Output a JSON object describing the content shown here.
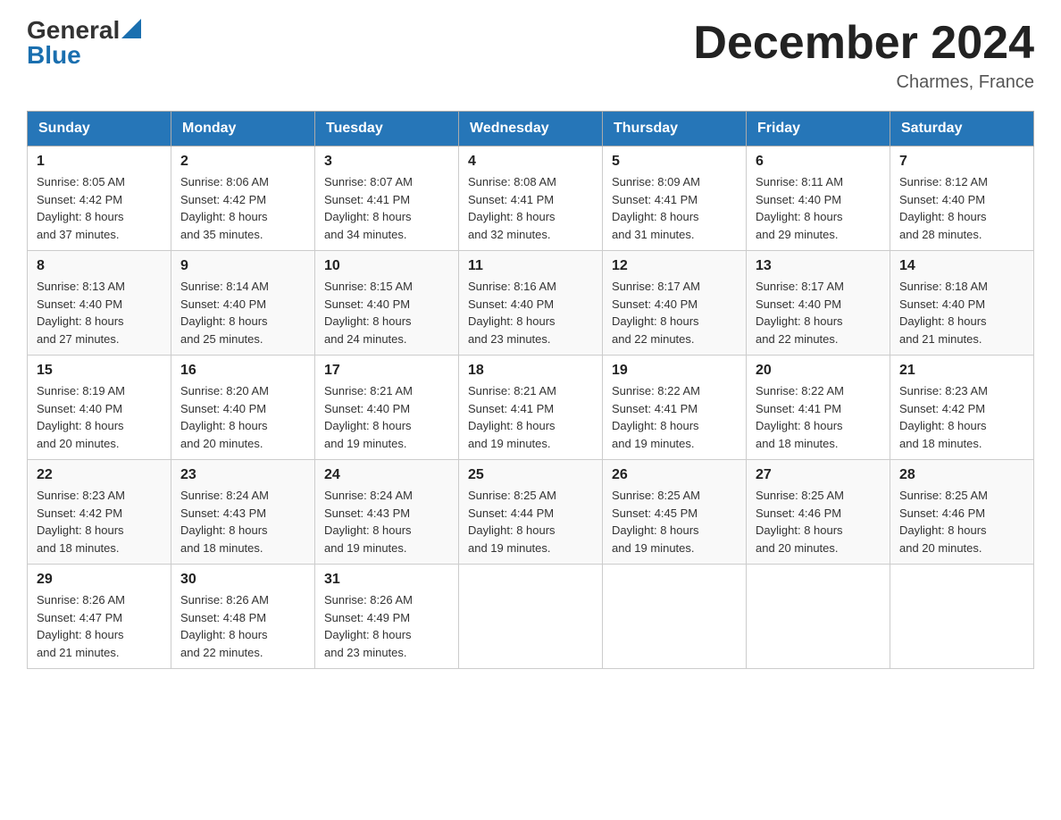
{
  "logo": {
    "general": "General",
    "blue": "Blue"
  },
  "title": "December 2024",
  "location": "Charmes, France",
  "days_of_week": [
    "Sunday",
    "Monday",
    "Tuesday",
    "Wednesday",
    "Thursday",
    "Friday",
    "Saturday"
  ],
  "weeks": [
    [
      {
        "day": "1",
        "sunrise": "8:05 AM",
        "sunset": "4:42 PM",
        "daylight": "8 hours and 37 minutes."
      },
      {
        "day": "2",
        "sunrise": "8:06 AM",
        "sunset": "4:42 PM",
        "daylight": "8 hours and 35 minutes."
      },
      {
        "day": "3",
        "sunrise": "8:07 AM",
        "sunset": "4:41 PM",
        "daylight": "8 hours and 34 minutes."
      },
      {
        "day": "4",
        "sunrise": "8:08 AM",
        "sunset": "4:41 PM",
        "daylight": "8 hours and 32 minutes."
      },
      {
        "day": "5",
        "sunrise": "8:09 AM",
        "sunset": "4:41 PM",
        "daylight": "8 hours and 31 minutes."
      },
      {
        "day": "6",
        "sunrise": "8:11 AM",
        "sunset": "4:40 PM",
        "daylight": "8 hours and 29 minutes."
      },
      {
        "day": "7",
        "sunrise": "8:12 AM",
        "sunset": "4:40 PM",
        "daylight": "8 hours and 28 minutes."
      }
    ],
    [
      {
        "day": "8",
        "sunrise": "8:13 AM",
        "sunset": "4:40 PM",
        "daylight": "8 hours and 27 minutes."
      },
      {
        "day": "9",
        "sunrise": "8:14 AM",
        "sunset": "4:40 PM",
        "daylight": "8 hours and 25 minutes."
      },
      {
        "day": "10",
        "sunrise": "8:15 AM",
        "sunset": "4:40 PM",
        "daylight": "8 hours and 24 minutes."
      },
      {
        "day": "11",
        "sunrise": "8:16 AM",
        "sunset": "4:40 PM",
        "daylight": "8 hours and 23 minutes."
      },
      {
        "day": "12",
        "sunrise": "8:17 AM",
        "sunset": "4:40 PM",
        "daylight": "8 hours and 22 minutes."
      },
      {
        "day": "13",
        "sunrise": "8:17 AM",
        "sunset": "4:40 PM",
        "daylight": "8 hours and 22 minutes."
      },
      {
        "day": "14",
        "sunrise": "8:18 AM",
        "sunset": "4:40 PM",
        "daylight": "8 hours and 21 minutes."
      }
    ],
    [
      {
        "day": "15",
        "sunrise": "8:19 AM",
        "sunset": "4:40 PM",
        "daylight": "8 hours and 20 minutes."
      },
      {
        "day": "16",
        "sunrise": "8:20 AM",
        "sunset": "4:40 PM",
        "daylight": "8 hours and 20 minutes."
      },
      {
        "day": "17",
        "sunrise": "8:21 AM",
        "sunset": "4:40 PM",
        "daylight": "8 hours and 19 minutes."
      },
      {
        "day": "18",
        "sunrise": "8:21 AM",
        "sunset": "4:41 PM",
        "daylight": "8 hours and 19 minutes."
      },
      {
        "day": "19",
        "sunrise": "8:22 AM",
        "sunset": "4:41 PM",
        "daylight": "8 hours and 19 minutes."
      },
      {
        "day": "20",
        "sunrise": "8:22 AM",
        "sunset": "4:41 PM",
        "daylight": "8 hours and 18 minutes."
      },
      {
        "day": "21",
        "sunrise": "8:23 AM",
        "sunset": "4:42 PM",
        "daylight": "8 hours and 18 minutes."
      }
    ],
    [
      {
        "day": "22",
        "sunrise": "8:23 AM",
        "sunset": "4:42 PM",
        "daylight": "8 hours and 18 minutes."
      },
      {
        "day": "23",
        "sunrise": "8:24 AM",
        "sunset": "4:43 PM",
        "daylight": "8 hours and 18 minutes."
      },
      {
        "day": "24",
        "sunrise": "8:24 AM",
        "sunset": "4:43 PM",
        "daylight": "8 hours and 19 minutes."
      },
      {
        "day": "25",
        "sunrise": "8:25 AM",
        "sunset": "4:44 PM",
        "daylight": "8 hours and 19 minutes."
      },
      {
        "day": "26",
        "sunrise": "8:25 AM",
        "sunset": "4:45 PM",
        "daylight": "8 hours and 19 minutes."
      },
      {
        "day": "27",
        "sunrise": "8:25 AM",
        "sunset": "4:46 PM",
        "daylight": "8 hours and 20 minutes."
      },
      {
        "day": "28",
        "sunrise": "8:25 AM",
        "sunset": "4:46 PM",
        "daylight": "8 hours and 20 minutes."
      }
    ],
    [
      {
        "day": "29",
        "sunrise": "8:26 AM",
        "sunset": "4:47 PM",
        "daylight": "8 hours and 21 minutes."
      },
      {
        "day": "30",
        "sunrise": "8:26 AM",
        "sunset": "4:48 PM",
        "daylight": "8 hours and 22 minutes."
      },
      {
        "day": "31",
        "sunrise": "8:26 AM",
        "sunset": "4:49 PM",
        "daylight": "8 hours and 23 minutes."
      },
      null,
      null,
      null,
      null
    ]
  ],
  "labels": {
    "sunrise": "Sunrise:",
    "sunset": "Sunset:",
    "daylight": "Daylight:"
  }
}
